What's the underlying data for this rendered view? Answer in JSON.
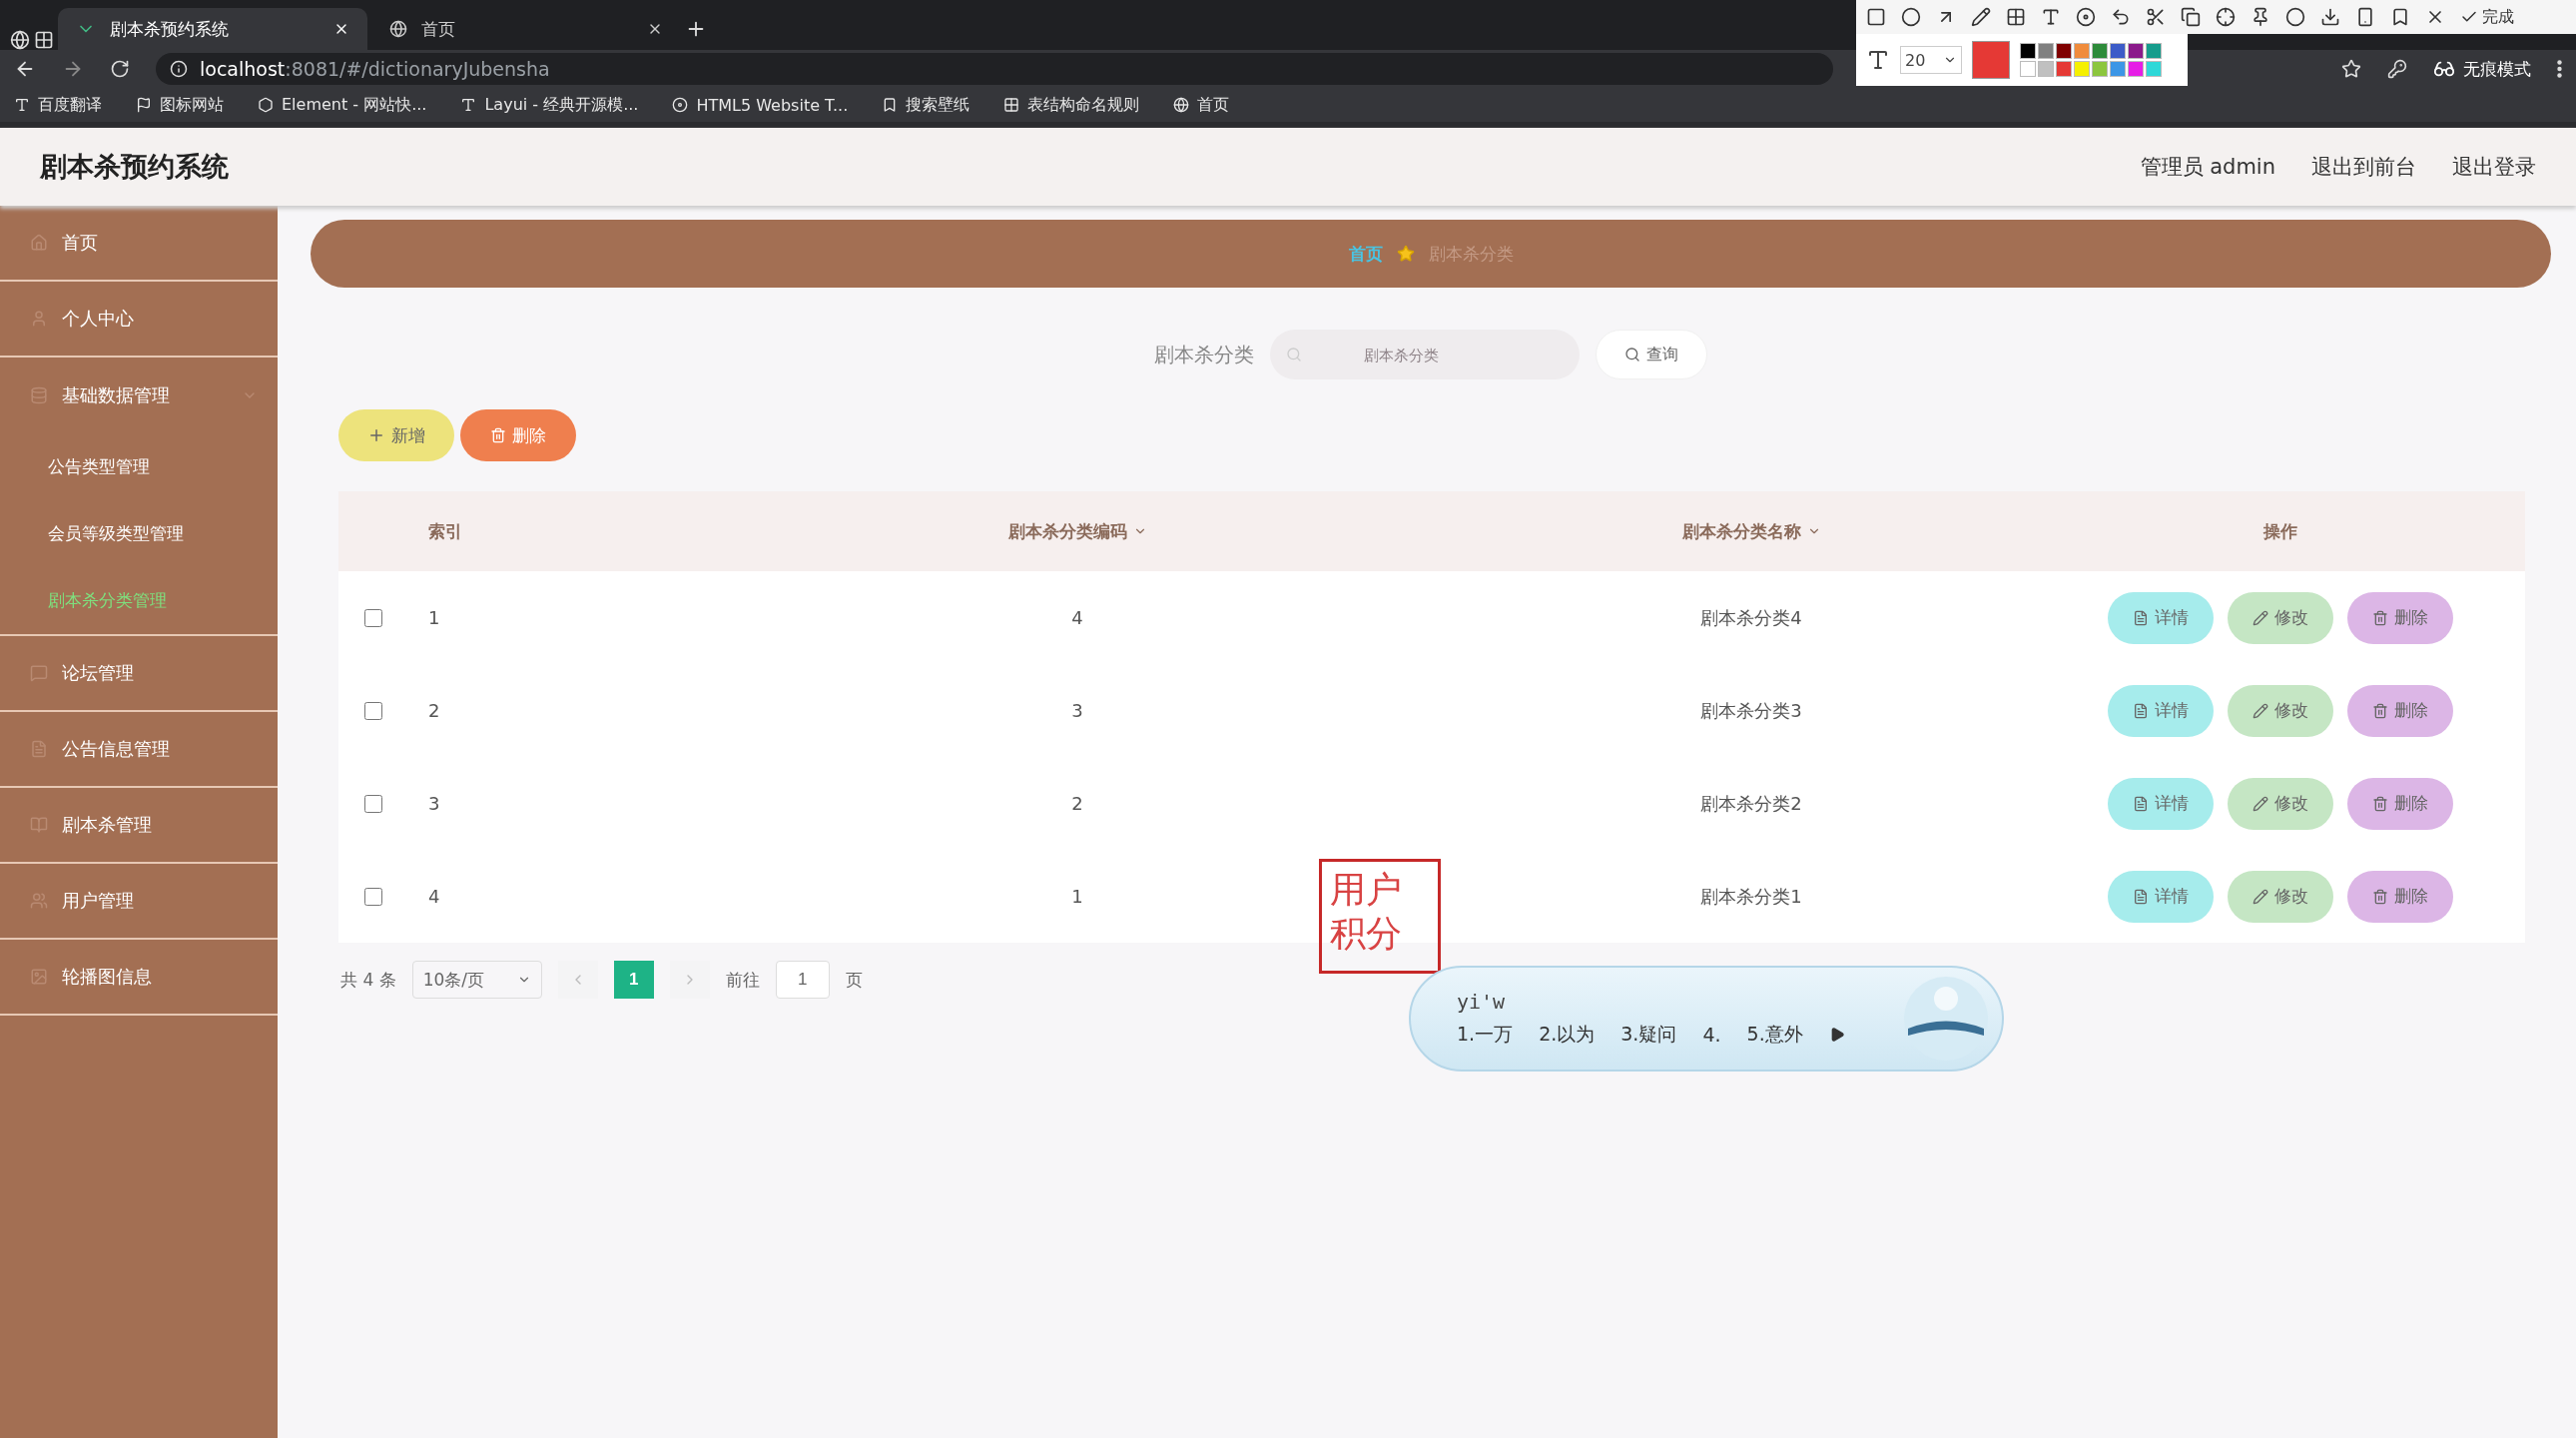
{
  "browser": {
    "tabs": [
      {
        "title": "剧本杀预约系统",
        "selected": true
      },
      {
        "title": "首页",
        "selected": false
      }
    ],
    "url_host": "localhost",
    "url_rest": ":8081/#/dictionaryJubensha",
    "profile": "无痕模式",
    "bookmarks": [
      "百度翻译",
      "图标网站",
      "Element - 网站快...",
      "Layui - 经典开源模...",
      "HTML5 Website T...",
      "搜索壁纸",
      "表结构命名规则",
      "首页"
    ]
  },
  "annotation_toolbar": {
    "font_size": "20",
    "done": "完成",
    "swatches": [
      {
        "color": "#000000"
      },
      {
        "color": "#808080"
      },
      {
        "color": "#800000"
      },
      {
        "color": "#f08c3c"
      },
      {
        "color": "#2e8b3a"
      },
      {
        "color": "#3c5cc8"
      },
      {
        "color": "#8b1a8b"
      },
      {
        "color": "#169c8c"
      },
      {
        "color": "#ffffff"
      },
      {
        "color": "#c0c0c0"
      },
      {
        "color": "#e53935"
      },
      {
        "color": "#f5f000"
      },
      {
        "color": "#8cc63e"
      },
      {
        "color": "#3c96e6"
      },
      {
        "color": "#e61ee6"
      },
      {
        "color": "#2ed8d8"
      }
    ]
  },
  "app": {
    "title": "剧本杀预约系统",
    "user_links": [
      "管理员 admin",
      "退出到前台",
      "退出登录"
    ],
    "sidebar": [
      {
        "label": "首页",
        "selected": false
      },
      {
        "label": "个人中心",
        "selected": false
      },
      {
        "label": "基础数据管理",
        "expanded": true,
        "children": [
          {
            "label": "公告类型管理",
            "selected": false
          },
          {
            "label": "会员等级类型管理",
            "selected": false
          },
          {
            "label": "剧本杀分类管理",
            "selected": true
          }
        ]
      },
      {
        "label": "论坛管理",
        "selected": false
      },
      {
        "label": "公告信息管理",
        "selected": false
      },
      {
        "label": "剧本杀管理",
        "selected": false
      },
      {
        "label": "用户管理",
        "selected": false
      },
      {
        "label": "轮播图信息",
        "selected": false
      }
    ],
    "breadcrumb": [
      "首页",
      "剧本杀分类"
    ],
    "search": {
      "label": "剧本杀分类",
      "placeholder": "剧本杀分类",
      "button": "查询"
    },
    "actions": [
      {
        "kind": "add",
        "label": "新增"
      },
      {
        "kind": "delete",
        "label": "删除"
      }
    ],
    "table": {
      "columns": [
        {
          "label": "索引",
          "sortable": false
        },
        {
          "label": "剧本杀分类编码",
          "sortable": true
        },
        {
          "label": "剧本杀分类名称",
          "sortable": true
        },
        {
          "label": "操作",
          "sortable": false
        }
      ],
      "rows": [
        {
          "checked": false,
          "cells": [
            "1",
            "4",
            "剧本杀分类4"
          ],
          "actions": [
            {
              "kind": "detail",
              "label": "详情"
            },
            {
              "kind": "edit",
              "label": "修改"
            },
            {
              "kind": "delete",
              "label": "删除"
            }
          ]
        },
        {
          "checked": false,
          "cells": [
            "2",
            "3",
            "剧本杀分类3"
          ],
          "actions": [
            {
              "kind": "detail",
              "label": "详情"
            },
            {
              "kind": "edit",
              "label": "修改"
            },
            {
              "kind": "delete",
              "label": "删除"
            }
          ]
        },
        {
          "checked": false,
          "cells": [
            "3",
            "2",
            "剧本杀分类2"
          ],
          "actions": [
            {
              "kind": "detail",
              "label": "详情"
            },
            {
              "kind": "edit",
              "label": "修改"
            },
            {
              "kind": "delete",
              "label": "删除"
            }
          ]
        },
        {
          "checked": false,
          "cells": [
            "4",
            "1",
            "剧本杀分类1"
          ],
          "actions": [
            {
              "kind": "detail",
              "label": "详情"
            },
            {
              "kind": "edit",
              "label": "修改"
            },
            {
              "kind": "delete",
              "label": "删除"
            }
          ]
        }
      ]
    },
    "pagination": {
      "total": "共 4 条",
      "page_size": "10条/页",
      "pages": [
        {
          "label": "1",
          "selected": true
        }
      ],
      "goto_label": "前往",
      "goto_value": "1",
      "page_suffix": "页"
    }
  },
  "annotation": {
    "text": "用户积分"
  },
  "ime": {
    "input": "yi'w",
    "candidates": [
      "1.一万",
      "2.以为",
      "3.疑问",
      "4.",
      "5.意外"
    ]
  }
}
